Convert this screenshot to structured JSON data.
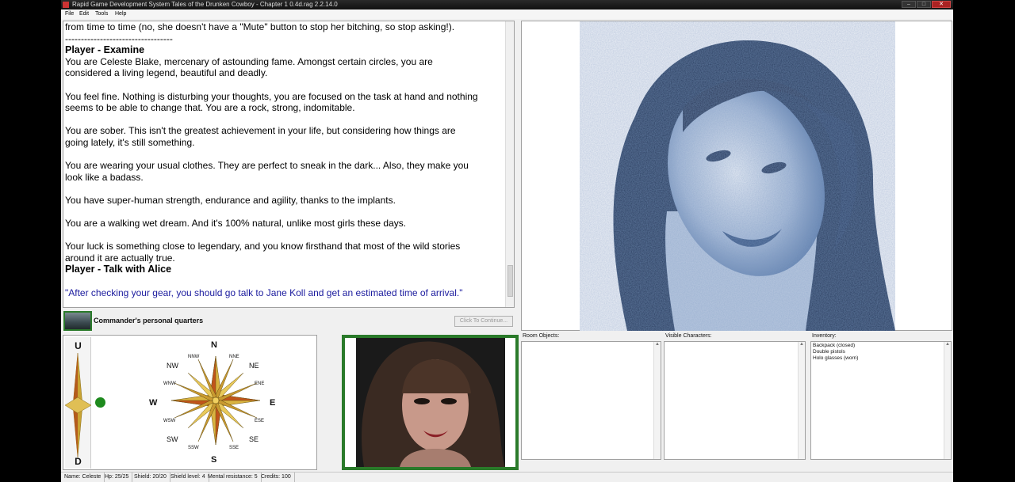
{
  "window": {
    "title": "Rapid Game Development System Tales of the Drunken Cowboy - Chapter 1 0.4d.rag 2.2.14.0"
  },
  "menu": [
    "File",
    "Edit",
    "Tools",
    "Help"
  ],
  "story": {
    "lines": [
      {
        "type": "text",
        "text": "from time to time (no, she doesn't have a \"Mute\" button to stop her bitching, so stop asking!)."
      },
      {
        "type": "text",
        "text": "----------------------------------"
      },
      {
        "type": "header",
        "text": "Player - Examine"
      },
      {
        "type": "text",
        "text": "You are Celeste Blake, mercenary of astounding fame. Amongst certain circles, you are"
      },
      {
        "type": "text",
        "text": "considered a living legend, beautiful and deadly."
      },
      {
        "type": "gap",
        "text": ""
      },
      {
        "type": "text",
        "text": "You feel fine. Nothing is disturbing your thoughts, you are focused on the task at hand and nothing"
      },
      {
        "type": "text",
        "text": "seems to be able to change that. You are a rock, strong, indomitable."
      },
      {
        "type": "gap",
        "text": ""
      },
      {
        "type": "text",
        "text": "You are sober. This isn't the greatest achievement in your life, but considering how things are"
      },
      {
        "type": "text",
        "text": "going lately, it's still something."
      },
      {
        "type": "gap",
        "text": ""
      },
      {
        "type": "text",
        "text": "You are wearing your usual clothes. They are perfect to sneak in the dark... Also, they make you"
      },
      {
        "type": "text",
        "text": "look like a badass."
      },
      {
        "type": "gap",
        "text": ""
      },
      {
        "type": "text",
        "text": "You have super-human strength, endurance and agility, thanks to the implants."
      },
      {
        "type": "gap",
        "text": ""
      },
      {
        "type": "text",
        "text": "You are a walking wet dream. And it's 100% natural, unlike most girls these days."
      },
      {
        "type": "gap",
        "text": ""
      },
      {
        "type": "text",
        "text": "Your luck is something close to legendary, and you know firsthand that most of the wild stories"
      },
      {
        "type": "text",
        "text": "around it are actually true."
      },
      {
        "type": "header",
        "text": "Player - Talk with Alice"
      },
      {
        "type": "gap",
        "text": ""
      },
      {
        "type": "quote",
        "text": "\"After checking your gear, you should go talk to Jane Koll and get an estimated time of arrival.\""
      }
    ]
  },
  "location": {
    "name": "Commander's personal quarters",
    "continue_label": "Click To Continue..."
  },
  "compass": {
    "up": "U",
    "down": "D",
    "N": "N",
    "S": "S",
    "E": "E",
    "W": "W",
    "NE": "NE",
    "NW": "NW",
    "SE": "SE",
    "SW": "SW",
    "NNE": "NNE",
    "NNW": "NNW",
    "ENE": "ENE",
    "ESE": "ESE",
    "SSE": "SSE",
    "SSW": "SSW",
    "WNW": "WNW",
    "WSW": "WSW"
  },
  "panels": {
    "room_objects": {
      "label": "Room Objects:",
      "items": []
    },
    "visible_characters": {
      "label": "Visible Characters:",
      "items": []
    },
    "inventory": {
      "label": "Inventory:",
      "items": [
        "Backpack (closed)",
        "Double pistols",
        "Holo glasses (worn)"
      ]
    }
  },
  "status": {
    "name": "Name: Celeste",
    "hp": "Hp: 25/25",
    "shield": "Shield: 20/20",
    "shield_level": "Shield level: 4",
    "mental": "Mental resistance: 5",
    "credits": "Credits: 100"
  },
  "colors": {
    "accent_green": "#2a7a2a",
    "quote_blue": "#1b1b9e",
    "portrait_tint": "#2b4d7d"
  }
}
